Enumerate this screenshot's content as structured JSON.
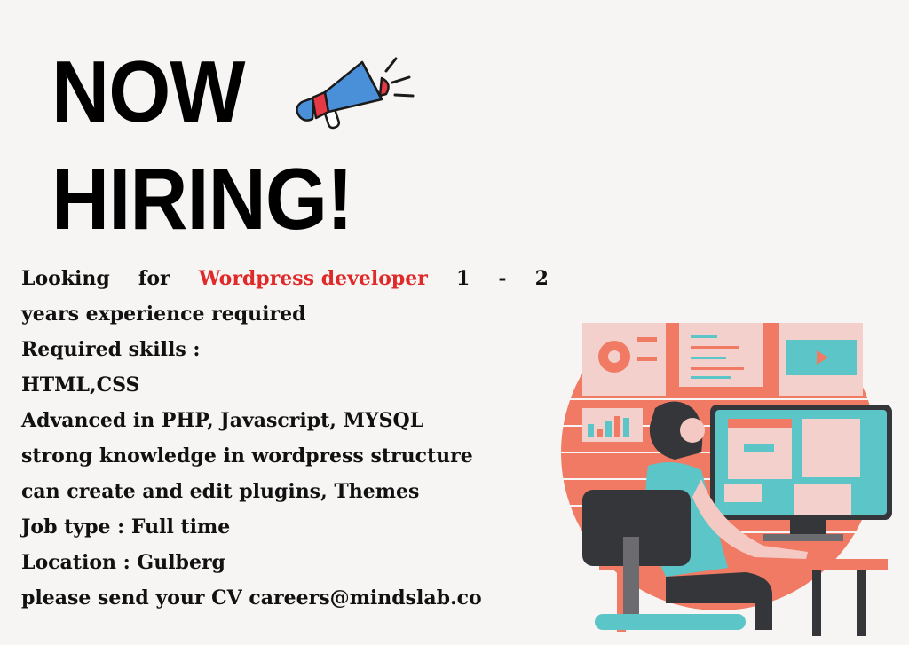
{
  "headline": {
    "line1": "NOW",
    "line2": "HIRING!"
  },
  "intro": {
    "prefix_1": "Looking",
    "prefix_2": "for",
    "highlight": "Wordpress developer",
    "suffix_1": "1",
    "suffix_dash": "-",
    "suffix_2": "2"
  },
  "lines": [
    "years experience required",
    "Required skills :",
    "HTML,CSS",
    "Advanced in PHP, Javascript, MYSQL",
    "strong knowledge in wordpress structure",
    "can create and edit plugins, Themes",
    "Job type : Full time",
    "Location : Gulberg",
    "please send your CV careers@mindslab.co"
  ],
  "colors": {
    "accent": "#e02a2a",
    "coral": "#f07a63",
    "teal": "#5bc5c8",
    "pink": "#f4d0cc",
    "dark": "#35363a",
    "megaphone_blue": "#4a90d9"
  },
  "icons": {
    "megaphone": "megaphone-icon",
    "illustration": "developer-at-computer-illustration"
  }
}
